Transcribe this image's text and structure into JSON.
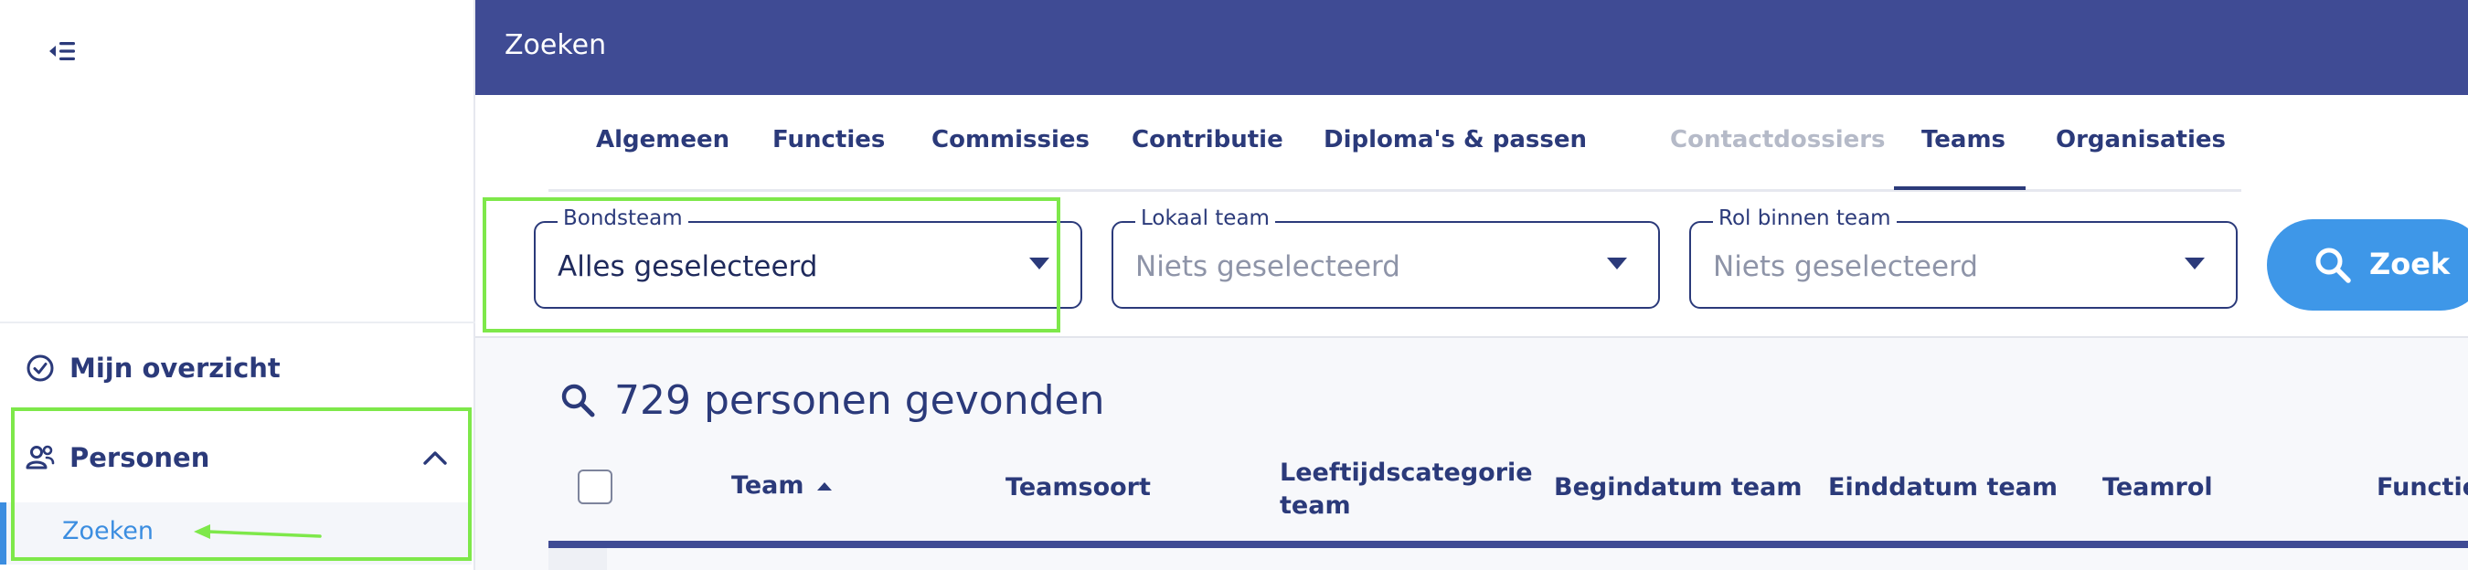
{
  "sidebar": {
    "collapse_icon": "collapse-menu-icon",
    "items": [
      {
        "label": "Mijn overzicht",
        "icon": "check-circle-icon"
      },
      {
        "label": "Personen",
        "icon": "people-icon",
        "expanded": true
      }
    ],
    "sub_items": [
      {
        "label": "Zoeken",
        "active": true
      }
    ]
  },
  "header": {
    "title": "Zoeken"
  },
  "tabs": [
    {
      "label": "Algemeen"
    },
    {
      "label": "Functies"
    },
    {
      "label": "Commissies"
    },
    {
      "label": "Contributie"
    },
    {
      "label": "Diploma's & passen"
    },
    {
      "label": "Contactdossiers",
      "disabled": true
    },
    {
      "label": "Teams",
      "active": true
    },
    {
      "label": "Organisaties"
    }
  ],
  "filters": {
    "bondsteam": {
      "label": "Bondsteam",
      "value": "Alles geselecteerd"
    },
    "lokaal_team": {
      "label": "Lokaal team",
      "placeholder": "Niets geselecteerd"
    },
    "rol": {
      "label": "Rol binnen team",
      "placeholder": "Niets geselecteerd"
    }
  },
  "search_button": {
    "label": "Zoek",
    "icon": "search-icon"
  },
  "results": {
    "summary": "729 personen gevonden",
    "icon": "search-icon"
  },
  "table": {
    "columns": [
      {
        "label": "Team",
        "sort": "asc"
      },
      {
        "label": "Teamsoort"
      },
      {
        "label": "Leeftijdscategorie team"
      },
      {
        "label": "Begindatum team"
      },
      {
        "label": "Einddatum team"
      },
      {
        "label": "Teamrol"
      },
      {
        "label": "Functie"
      }
    ]
  },
  "colors": {
    "brand": "#3f4b94",
    "accent": "#3e97e8",
    "text": "#2b3a7a",
    "annotation": "#7ee84a"
  }
}
